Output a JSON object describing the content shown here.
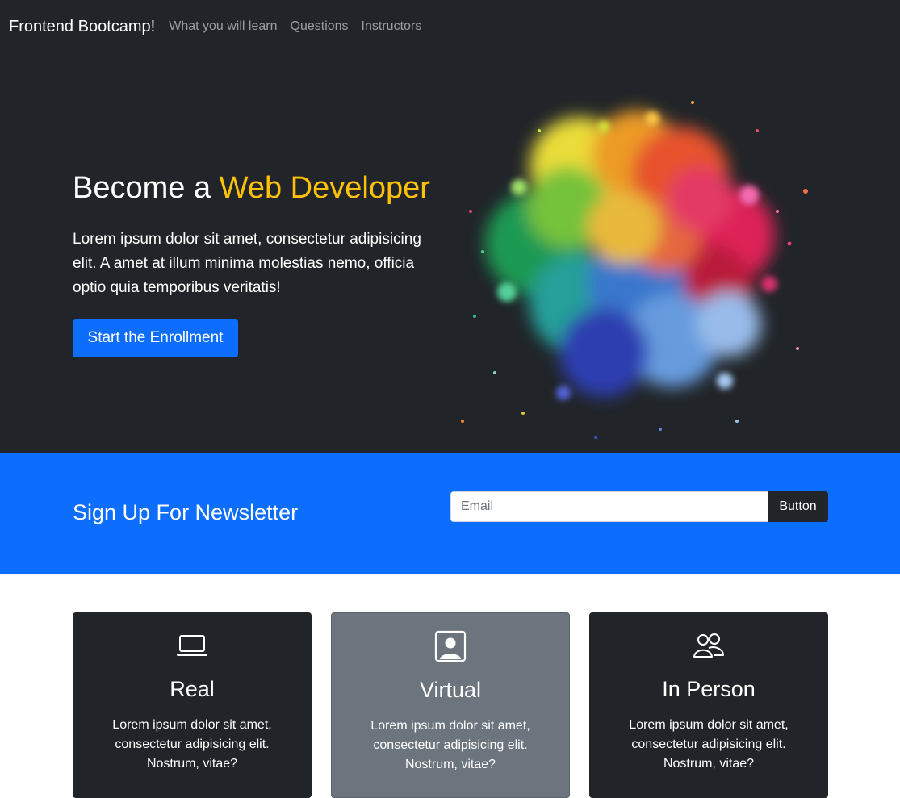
{
  "navbar": {
    "brand": "Frontend Bootcamp!",
    "links": [
      "What you will learn",
      "Questions",
      "Instructors"
    ]
  },
  "hero": {
    "title_prefix": "Become a",
    "title_accent": "Web Developer",
    "text": "Lorem ipsum dolor sit amet, consectetur adipisicing elit. A amet at illum minima molestias nemo, officia optio quia temporibus veritatis!",
    "button_label": "Start the Enrollment",
    "image_icon": "paint-splash-illustration"
  },
  "newsletter": {
    "title": "Sign Up For Newsletter",
    "email_placeholder": "Email",
    "email_value": "",
    "button_label": "Button"
  },
  "cards": [
    {
      "icon": "laptop-icon",
      "title": "Real",
      "text": "Lorem ipsum dolor sit amet, consectetur adipisicing elit. Nostrum, vitae?"
    },
    {
      "icon": "person-square-icon",
      "title": "Virtual",
      "text": "Lorem ipsum dolor sit amet, consectetur adipisicing elit. Nostrum, vitae?"
    },
    {
      "icon": "people-icon",
      "title": "In Person",
      "text": "Lorem ipsum dolor sit amet, consectetur adipisicing elit. Nostrum, vitae?"
    }
  ],
  "colors": {
    "dark": "#212529",
    "primary": "#0d6efd",
    "warning": "#ffc107",
    "secondary": "#6c757d"
  }
}
